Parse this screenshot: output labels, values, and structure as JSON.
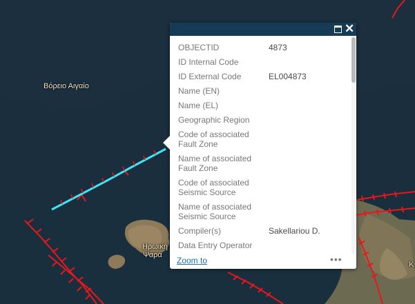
{
  "map": {
    "labels": {
      "north_aegean": "Βόρειο Αιγαίο",
      "island_line1": "Ηρωική Ν",
      "island_line2": "Ψαρά",
      "edge_letter": "Κ"
    },
    "colors": {
      "sea": "#1a2d3c",
      "fault": "#e8171c",
      "selected_fault": "#3fe6f2",
      "popup_header": "#163c55",
      "link": "#1a6fb5"
    }
  },
  "popup": {
    "fields": [
      {
        "key": "OBJECTID",
        "value": "4873"
      },
      {
        "key": "ID Internal Code",
        "value": ""
      },
      {
        "key": "ID External Code",
        "value": "EL004873"
      },
      {
        "key": "Name (EN)",
        "value": ""
      },
      {
        "key": "Name (EL)",
        "value": ""
      },
      {
        "key": "Geographic Region",
        "value": ""
      },
      {
        "key": "Code of associated Fault Zone",
        "value": ""
      },
      {
        "key": "Name of associated Fault Zone",
        "value": ""
      },
      {
        "key": "Code of associated Seismic Source",
        "value": ""
      },
      {
        "key": "Name of associated Seismic Source",
        "value": ""
      },
      {
        "key": "Compiler(s)",
        "value": "Sakellariou D."
      },
      {
        "key": "Data Entry Operator",
        "value": ""
      }
    ],
    "zoom_label": "Zoom to",
    "more_label": "•••",
    "close_label": "✕",
    "icons": {
      "maximize": "maximize-icon",
      "close": "close-icon",
      "more": "more-options-icon"
    }
  }
}
